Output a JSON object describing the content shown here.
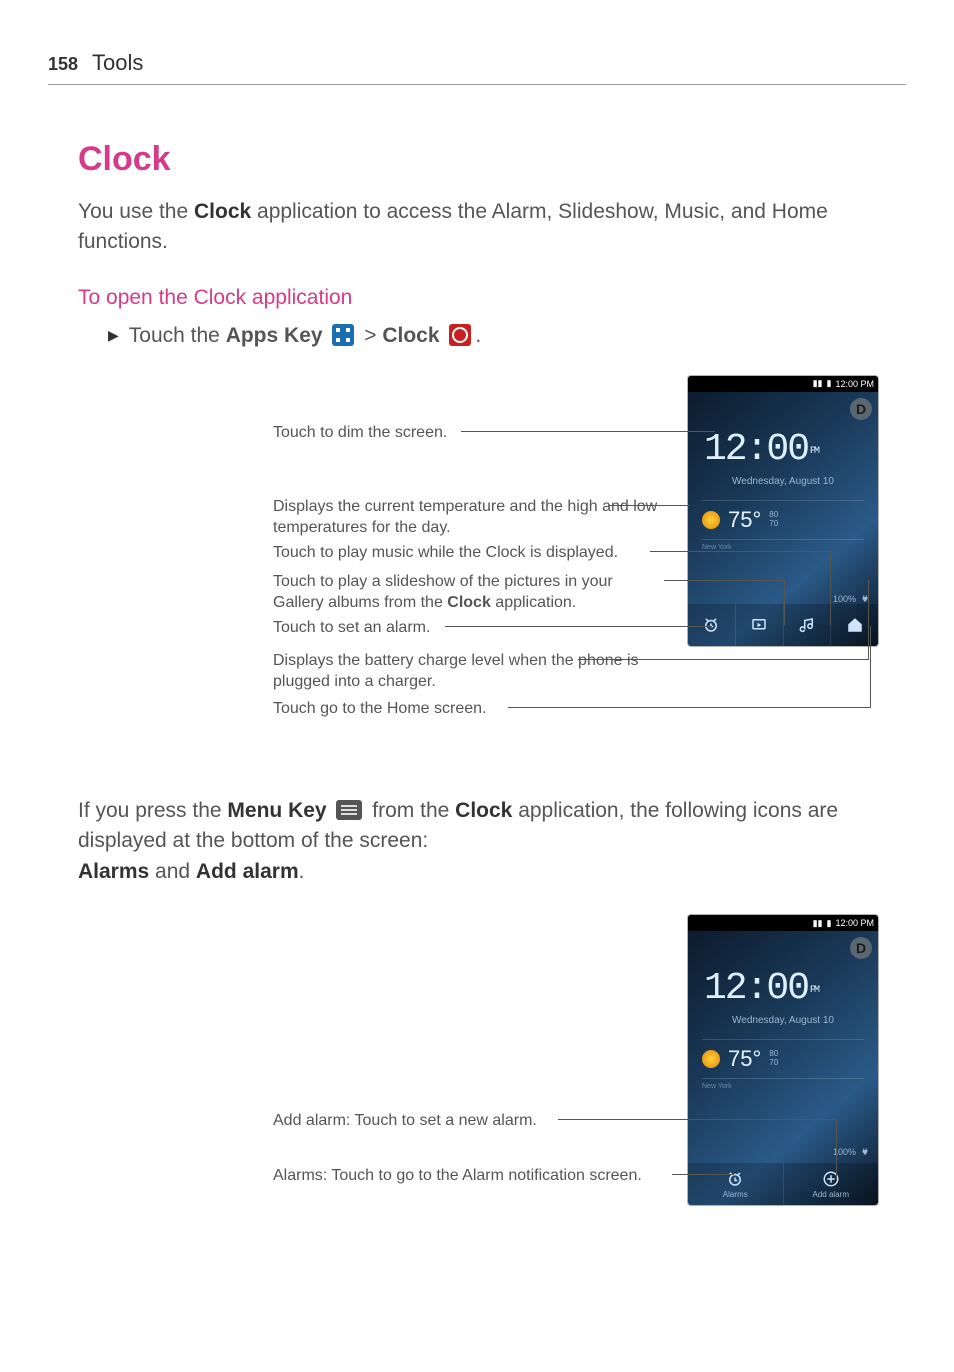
{
  "header": {
    "page_num": "158",
    "section": "Tools"
  },
  "title": "Clock",
  "intro": {
    "pre": "You use the ",
    "bold1": "Clock",
    "post": " application to access the Alarm, Slideshow, Music, and Home functions."
  },
  "subhead1": "To open the Clock application",
  "step1": {
    "pre": "Touch the ",
    "bold1": "Apps Key",
    "mid": " > ",
    "bold2": "Clock",
    "post": "."
  },
  "phone1": {
    "status_time": "12:00 PM",
    "dim_label": "D",
    "big_time": "12:00",
    "ampm": "PM",
    "date": "Wednesday, August 10",
    "temp": "75°",
    "hi": "80",
    "lo": "70",
    "city": "New York",
    "battery": "100%"
  },
  "callouts1": {
    "dim": "Touch to dim the screen.",
    "weather": "Displays the current temperature and the high and low temperatures for the day.",
    "music": "Touch to play music while the Clock is displayed.",
    "slideshow_pre": "Touch to play a slideshow of the pictures in your Gallery albums from the ",
    "slideshow_bold": "Clock",
    "slideshow_post": " application.",
    "alarm": "Touch to set an alarm.",
    "battery": "Displays the battery charge level when the phone is plugged into a charger.",
    "home": "Touch go to the Home screen."
  },
  "para2": {
    "pre": "If you press the ",
    "bold1": "Menu Key",
    "mid": " from the ",
    "bold2": "Clock",
    "post": " application, the following icons are displayed at the bottom of the screen:",
    "line2_b1": "Alarms",
    "line2_mid": " and ",
    "line2_b2": "Add alarm",
    "line2_post": "."
  },
  "phone2": {
    "menu_alarms": "Alarms",
    "menu_add": "Add alarm"
  },
  "callouts2": {
    "add_alarm": "Add alarm: Touch to set a new alarm.",
    "alarms": "Alarms: Touch to go to the Alarm notification screen."
  }
}
